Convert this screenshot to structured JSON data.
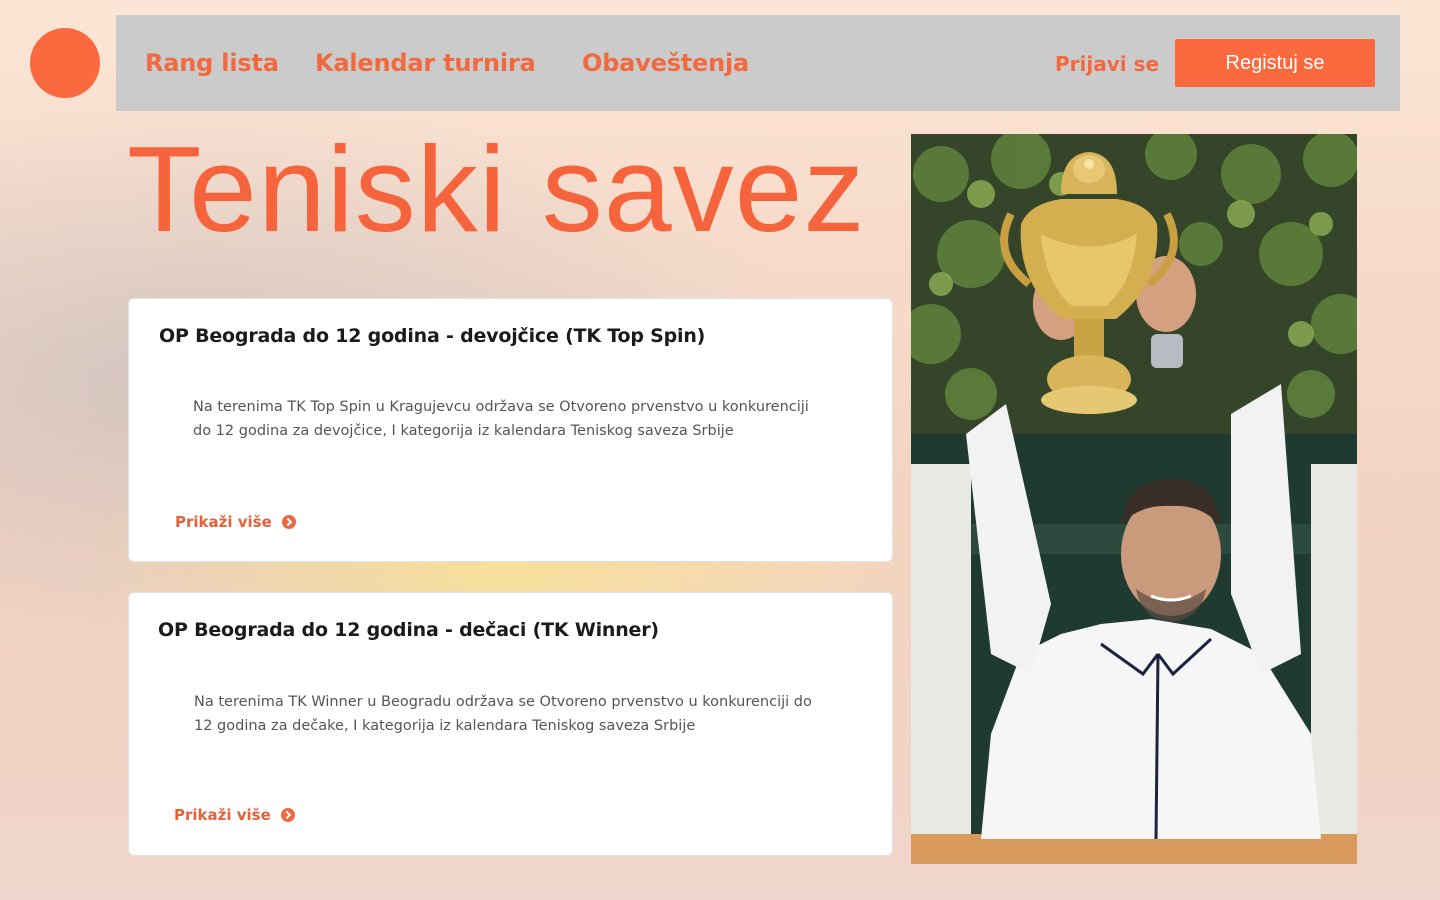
{
  "nav": {
    "links": [
      "Rang lista",
      "Kalendar turnira",
      "Obaveštenja"
    ],
    "login": "Prijavi se",
    "register": "Registuj se"
  },
  "hero": {
    "title": "Teniski savez"
  },
  "cards": [
    {
      "title": "OP Beograda do 12 godina - devojčice (TK Top Spin)",
      "text": "Na terenima TK Top Spin u Kragujevcu održava se Otvoreno prvenstvo u konkurenciji do 12 godina za devojčice, I kategorija iz kalendara Teniskog saveza Srbije",
      "more": "Prikaži više"
    },
    {
      "title": "OP Beograda do 12 godina - dečaci (TK Winner)",
      "text": "Na terenima TK Winner u Beogradu održava se Otvoreno prvenstvo u konkurenciji do 12 godina za dečake, I kategorija iz kalendara Teniskog saveza Srbije",
      "more": "Prikaži više"
    }
  ],
  "colors": {
    "accent": "#fa6a3e",
    "nav_bg": "#cbcbcb",
    "title": "#f5643d"
  },
  "icons": {
    "logo": "logo-circle",
    "more": "chevron-right-circle-icon"
  }
}
